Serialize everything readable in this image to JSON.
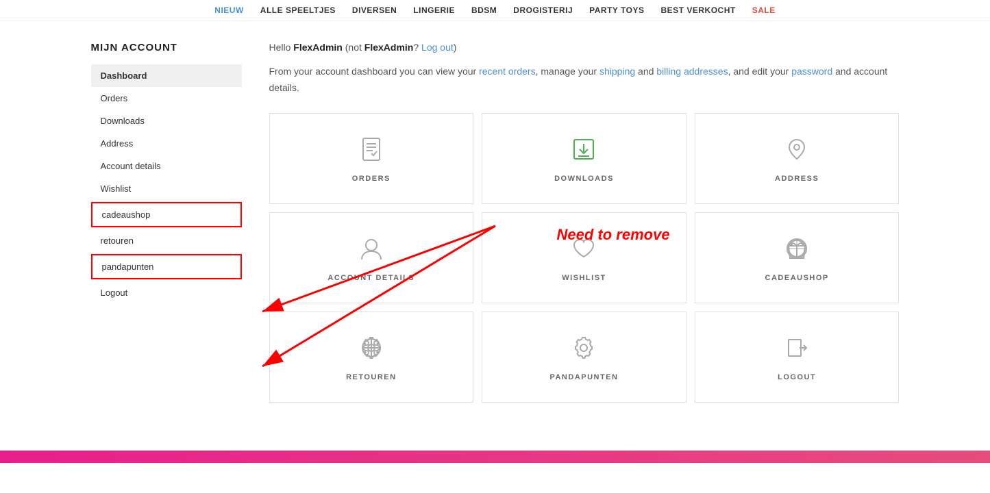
{
  "nav": {
    "items": [
      {
        "label": "NIEUW",
        "active": true
      },
      {
        "label": "ALLE SPEELTJES",
        "active": false
      },
      {
        "label": "DIVERSEN",
        "active": false
      },
      {
        "label": "LINGERIE",
        "active": false
      },
      {
        "label": "BDSM",
        "active": false
      },
      {
        "label": "DROGISTERIJ",
        "active": false
      },
      {
        "label": "PARTY TOYS",
        "active": false
      },
      {
        "label": "BEST VERKOCHT",
        "active": false
      },
      {
        "label": "SALE",
        "active": false,
        "sale": true
      }
    ]
  },
  "sidebar": {
    "title": "MIJN ACCOUNT",
    "items": [
      {
        "label": "Dashboard",
        "active": true,
        "highlighted": false
      },
      {
        "label": "Orders",
        "active": false,
        "highlighted": false
      },
      {
        "label": "Downloads",
        "active": false,
        "highlighted": false
      },
      {
        "label": "Address",
        "active": false,
        "highlighted": false
      },
      {
        "label": "Account details",
        "active": false,
        "highlighted": false
      },
      {
        "label": "Wishlist",
        "active": false,
        "highlighted": false
      },
      {
        "label": "cadeaushop",
        "active": false,
        "highlighted": true
      },
      {
        "label": "retouren",
        "active": false,
        "highlighted": false
      },
      {
        "label": "pandapunten",
        "active": false,
        "highlighted": true
      },
      {
        "label": "Logout",
        "active": false,
        "highlighted": false
      }
    ]
  },
  "greeting": {
    "hello": "Hello ",
    "username": "FlexAdmin",
    "not_text": " (not ",
    "not_username": "FlexAdmin",
    "logout_text": "? Log out",
    "close_paren": ")"
  },
  "description": {
    "text1": "From your account dashboard you can view your ",
    "link1": "recent orders",
    "text2": ", manage your ",
    "link2": "shipping",
    "text3": " and ",
    "link3": "billing addresses",
    "text4": ", and edit your ",
    "link4": "password",
    "text5": " and account details."
  },
  "tiles": [
    {
      "label": "ORDERS",
      "icon": "orders"
    },
    {
      "label": "DOWNLOADS",
      "icon": "downloads",
      "active": true
    },
    {
      "label": "ADDRESS",
      "icon": "address"
    },
    {
      "label": "ACCOUNT DETAILS",
      "icon": "account"
    },
    {
      "label": "WISHLIST",
      "icon": "wishlist"
    },
    {
      "label": "CADEAUSHOP",
      "icon": "cadeaushop"
    },
    {
      "label": "RETOUREN",
      "icon": "retouren"
    },
    {
      "label": "PANDAPUNTEN",
      "icon": "pandapunten"
    },
    {
      "label": "LOGOUT",
      "icon": "logout"
    }
  ],
  "annotation": {
    "text": "Need to remove"
  }
}
